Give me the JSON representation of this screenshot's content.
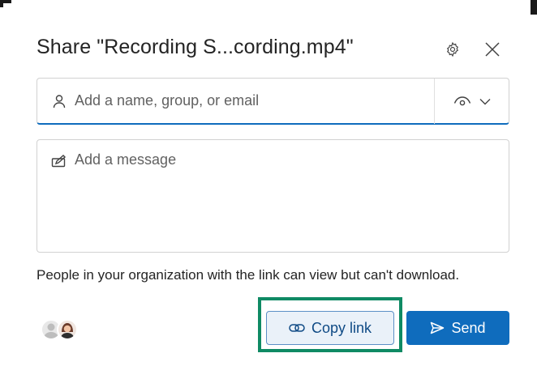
{
  "dialog": {
    "title": "Share \"Recording S...cording.mp4\""
  },
  "header": {
    "settings_icon": "gear-icon",
    "close_icon": "close-icon"
  },
  "recipients": {
    "placeholder": "Add a name, group, or email",
    "value": "",
    "icon": "person-icon",
    "permission_icon": "eye-icon",
    "permission_dropdown_icon": "chevron-down-icon"
  },
  "message": {
    "placeholder": "Add a message",
    "value": "",
    "icon": "pen-icon"
  },
  "info": {
    "text": "People in your organization with the link can view but can't download."
  },
  "actions": {
    "copy_link_label": "Copy link",
    "copy_link_icon": "link-icon",
    "send_label": "Send",
    "send_icon": "send-icon"
  },
  "colors": {
    "accent": "#0f6cbd",
    "highlight": "#0f8a64",
    "copy_bg": "#eaf1f9"
  }
}
